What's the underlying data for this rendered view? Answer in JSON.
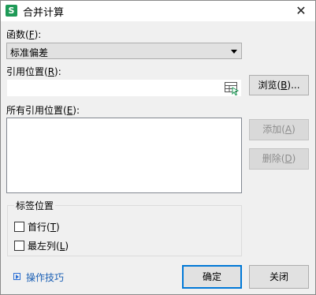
{
  "window": {
    "app_icon": "S",
    "title": "合并计算",
    "close_glyph": "✕"
  },
  "function": {
    "label_text": "函数(",
    "label_key": "F",
    "label_end": "):",
    "selected": "标准偏差"
  },
  "reference": {
    "label_text": "引用位置(",
    "label_key": "R",
    "label_end": "):",
    "value": "",
    "picker_icon": "range-picker-icon"
  },
  "browse_button": {
    "text": "浏览(",
    "key": "B",
    "end": ")..."
  },
  "all_refs": {
    "label_text": "所有引用位置(",
    "label_key": "E",
    "label_end": "):",
    "items": []
  },
  "add_button": {
    "text": "添加(",
    "key": "A",
    "end": ")"
  },
  "delete_button": {
    "text": "删除(",
    "key": "D",
    "end": ")"
  },
  "label_position": {
    "title": "标签位置",
    "top_row": {
      "text": "首行(",
      "key": "T",
      "end": ")",
      "checked": false
    },
    "left_column": {
      "text": "最左列(",
      "key": "L",
      "end": ")",
      "checked": false
    }
  },
  "tips": {
    "text": "操作技巧",
    "icon": "play-icon"
  },
  "ok_button": "确定",
  "close_button": "关闭",
  "colors": {
    "accent": "#0078d7",
    "app_icon_bg": "#1e9a57",
    "link": "#1a5fb4",
    "disabled_text": "#8d8d8d"
  }
}
